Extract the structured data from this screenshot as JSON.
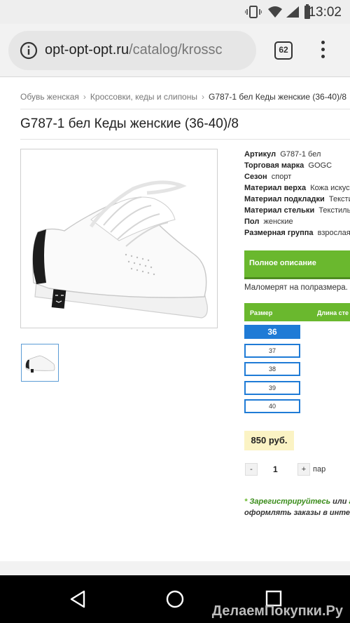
{
  "status_bar": {
    "time": "13:02"
  },
  "browser": {
    "url_domain": "opt-opt-opt.ru",
    "url_path": "/catalog/krossc",
    "tab_count": "62"
  },
  "breadcrumb": {
    "items": [
      "Обувь женская",
      "Кроссовки, кеды и слипоны"
    ],
    "current": "G787-1 бел Кеды женские (36-40)/8"
  },
  "product": {
    "title": "G787-1 бел Кеды женские (36-40)/8",
    "specs": [
      {
        "label": "Артикул",
        "value": "G787-1 бел"
      },
      {
        "label": "Торговая марка",
        "value": "GOGC"
      },
      {
        "label": "Сезон",
        "value": "спорт"
      },
      {
        "label": "Материал верха",
        "value": "Кожа искуссс"
      },
      {
        "label": "Материал подкладки",
        "value": "Текстиль"
      },
      {
        "label": "Материал стельки",
        "value": "Текстиль"
      },
      {
        "label": "Пол",
        "value": "женские"
      },
      {
        "label": "Размерная группа",
        "value": "взрослая"
      }
    ],
    "full_description_label": "Полное описание",
    "note": "Маломерят на полразмера.",
    "size_header": {
      "size": "Размер",
      "length": "Длина сте"
    },
    "sizes": [
      "36",
      "37",
      "38",
      "39",
      "40"
    ],
    "selected_size": "36",
    "price": "850 руб.",
    "qty_minus": "-",
    "qty_plus": "+",
    "quantity": "1",
    "unit": "пар",
    "register": {
      "star": "*",
      "link": "Зарегистрируйтесь",
      "or": "или",
      "link2": "ав",
      "line2": "оформлять заказы в интер"
    }
  },
  "watermark": "ДелаемПокупки.Ру",
  "colors": {
    "accent_green": "#6ab82e",
    "size_blue": "#1f7bd6",
    "price_bg": "#fbf3c4"
  }
}
